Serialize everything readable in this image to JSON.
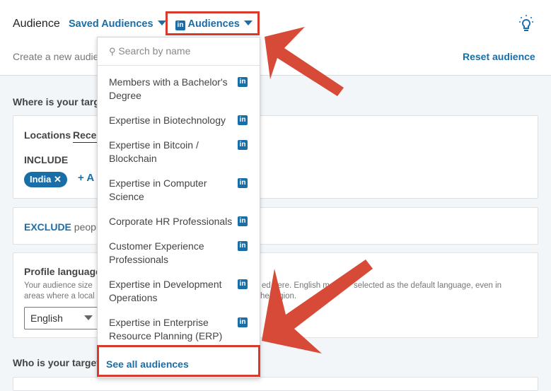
{
  "header": {
    "title": "Audience",
    "saved_audiences": "Saved Audiences",
    "audiences": "Audiences",
    "audiences_logo": "in",
    "subtitle": "Create a new audien",
    "reset": "Reset audience",
    "bulb_icon": "lightbulb-icon"
  },
  "locations": {
    "section_title": "Where is your targe",
    "tab_locations": "Locations",
    "tab_recent": "Recen",
    "include": "INCLUDE",
    "chip": "India",
    "add": "A"
  },
  "exclude": {
    "label": "EXCLUDE",
    "rest": "peopl"
  },
  "language": {
    "title": "Profile language",
    "desc_left_1": "Your audience size",
    "desc_left_2": "areas where a local",
    "desc_right_1a": "ed here. English m",
    "desc_right_1b": "selected as the default language, even in",
    "desc_right_2": "he region.",
    "selected": "English"
  },
  "who": {
    "section_title": "Who is your target"
  },
  "dropdown": {
    "search_placeholder": "Search by name",
    "items": [
      {
        "label": "Members with a Bachelor's Degree"
      },
      {
        "label": "Expertise in Biotechnology"
      },
      {
        "label": "Expertise in Bitcoin / Blockchain"
      },
      {
        "label": "Expertise in Computer Science"
      },
      {
        "label": "Corporate HR Professionals"
      },
      {
        "label": "Customer Experience Professionals"
      },
      {
        "label": "Expertise in Development Operations"
      },
      {
        "label": "Expertise in Enterprise Resource Planning (ERP)"
      }
    ],
    "see_all": "See all audiences"
  },
  "colors": {
    "accent": "#1a6ea8",
    "annotation": "#d83a2c",
    "background": "#f3f6f8"
  }
}
